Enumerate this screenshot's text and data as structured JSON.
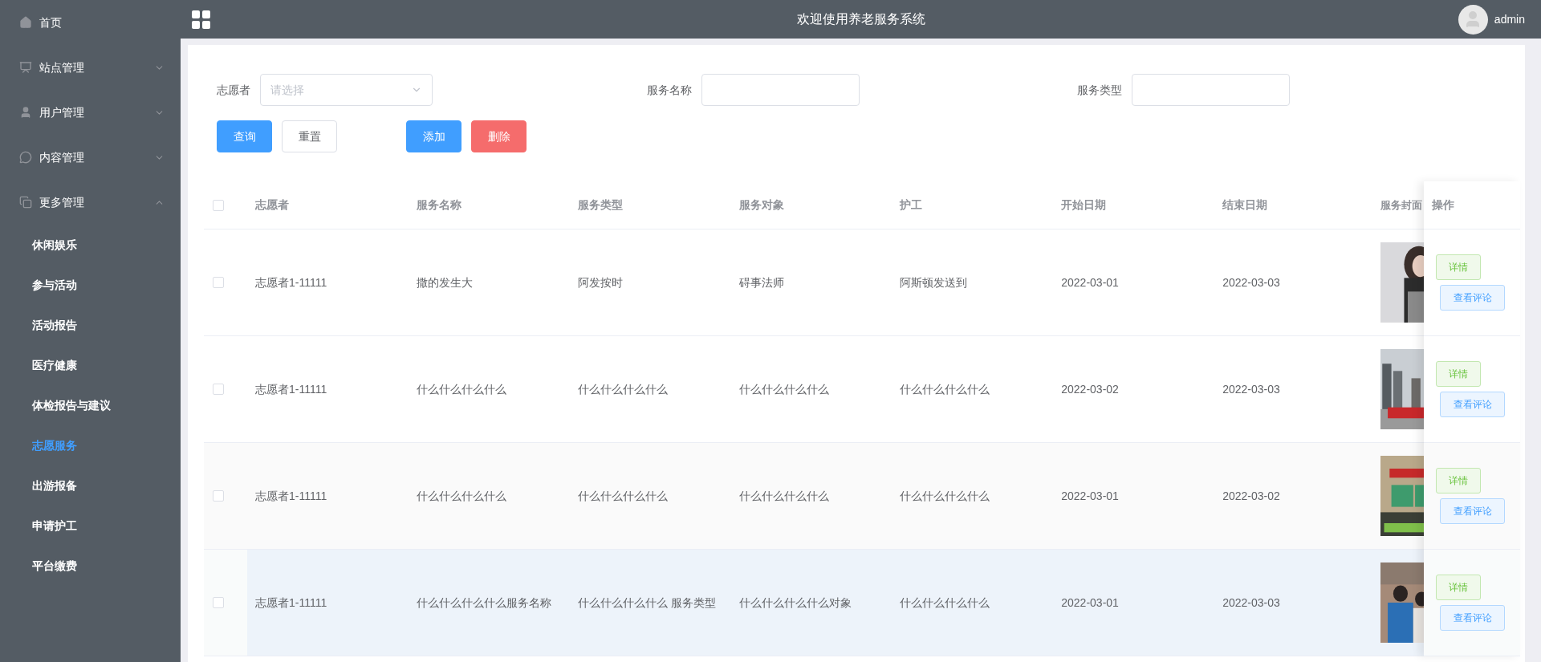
{
  "sidebar": {
    "items": [
      {
        "label": "首页"
      },
      {
        "label": "站点管理",
        "expanded": false
      },
      {
        "label": "用户管理",
        "expanded": false
      },
      {
        "label": "内容管理",
        "expanded": false
      },
      {
        "label": "更多管理",
        "expanded": true,
        "children": [
          {
            "label": "休闲娱乐",
            "selected": false
          },
          {
            "label": "参与活动",
            "selected": false
          },
          {
            "label": "活动报告",
            "selected": false
          },
          {
            "label": "医疗健康",
            "selected": false
          },
          {
            "label": "体检报告与建议",
            "selected": false
          },
          {
            "label": "志愿服务",
            "selected": true
          },
          {
            "label": "出游报备",
            "selected": false
          },
          {
            "label": "申请护工",
            "selected": false
          },
          {
            "label": "平台缴费",
            "selected": false
          }
        ]
      }
    ]
  },
  "header": {
    "title": "欢迎使用养老服务系统",
    "user": "admin"
  },
  "filters": [
    {
      "kind": "select",
      "label": "志愿者",
      "placeholder": "请选择"
    },
    {
      "kind": "input",
      "label": "服务名称"
    },
    {
      "kind": "input",
      "label": "服务类型"
    }
  ],
  "buttons": [
    {
      "label": "查询",
      "kind": "primary"
    },
    {
      "label": "重置",
      "kind": "default"
    },
    {
      "label": "添加",
      "kind": "primary"
    },
    {
      "label": "删除",
      "kind": "danger"
    }
  ],
  "table": {
    "select_all": {
      "checked": false
    },
    "columns": [
      "志愿者",
      "服务名称",
      "服务类型",
      "服务对象",
      "护工",
      "开始日期",
      "结束日期",
      "服务封面",
      "操作"
    ],
    "rows": [
      {
        "checked": false,
        "highlighted": false,
        "cells": [
          "志愿者1-11111",
          "撒的发生大",
          "阿发按时",
          "碍事法师",
          "阿斯顿发送到",
          "2022-03-01",
          "2022-03-03"
        ],
        "cover": {
          "kind": "picture"
        },
        "actions": [
          "详情",
          "查看评论"
        ]
      },
      {
        "checked": false,
        "highlighted": false,
        "cells": [
          "志愿者1-11111",
          "什么什么什么什么",
          "什么什么什么什么",
          "什么什么什么什么",
          "什么什么什么什么",
          "2022-03-02",
          "2022-03-03"
        ],
        "cover": {
          "kind": "picture"
        },
        "actions": [
          "详情",
          "查看评论"
        ]
      },
      {
        "checked": false,
        "highlighted": false,
        "cells": [
          "志愿者1-11111",
          "什么什么什么什么",
          "什么什么什么什么",
          "什么什么什么什么",
          "什么什么什么什么",
          "2022-03-01",
          "2022-03-02"
        ],
        "cover": {
          "kind": "picture"
        },
        "actions": [
          "详情",
          "查看评论"
        ]
      },
      {
        "checked": false,
        "highlighted": true,
        "cells": [
          "志愿者1-11111",
          "什么什么什么什么服务名称",
          "什么什么什么什么 服务类型",
          "什么什么什么什么对象",
          "什么什么什么什么",
          "2022-03-01",
          "2022-03-03"
        ],
        "cover": {
          "kind": "picture"
        },
        "actions": [
          "详情",
          "查看评论"
        ]
      }
    ]
  }
}
